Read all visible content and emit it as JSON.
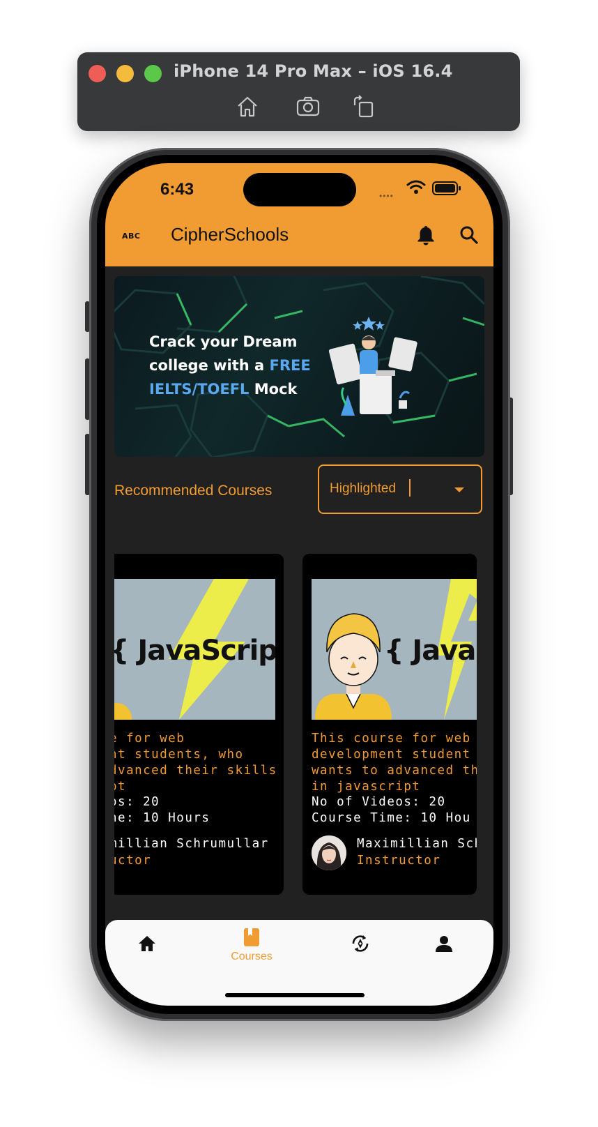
{
  "simulator": {
    "title": "iPhone 14 Pro Max – iOS 16.4",
    "toolbar_icons": [
      "home-icon",
      "screenshot-icon",
      "rotate-icon"
    ]
  },
  "status_bar": {
    "time": "6:43",
    "icons": [
      "wifi-icon",
      "battery-icon"
    ]
  },
  "app_bar": {
    "leading_text": "ABC",
    "title": "CipherSchools",
    "actions": [
      "bell-icon",
      "search-icon"
    ],
    "color": "#f19b33"
  },
  "banner": {
    "line1": "Crack your Dream",
    "line2_prefix": "college with a ",
    "line2_highlight": "FREE",
    "line3_highlight": "IELTS/TOEFL",
    "line3_suffix": " Mock"
  },
  "recommended": {
    "label": "Recommended Courses",
    "dropdown_value": "Highlighted"
  },
  "courses": [
    {
      "image_text": "{ JavaScript }",
      "desc_lines": [
        "e for web",
        "nt students, who",
        "dvanced their skills",
        "pt"
      ],
      "videos": "os: 20",
      "time": "ne: 10 Hours",
      "instructor": "millian Schrumullar",
      "role": "uctor"
    },
    {
      "image_text": "{ JavaS",
      "desc_lines": [
        "This course for web",
        "development student",
        "wants to advanced th",
        "in javascript"
      ],
      "videos": "No of Videos: 20",
      "time": "Course Time: 10 Hou",
      "instructor": "Maximillian Sch",
      "role": "Instructor"
    }
  ],
  "bottom_nav": {
    "items": [
      {
        "icon": "home-icon",
        "label": ""
      },
      {
        "icon": "book-icon",
        "label": "Courses",
        "active": true
      },
      {
        "icon": "compass-refresh-icon",
        "label": ""
      },
      {
        "icon": "person-icon",
        "label": ""
      }
    ],
    "active_color": "#f19b33"
  }
}
